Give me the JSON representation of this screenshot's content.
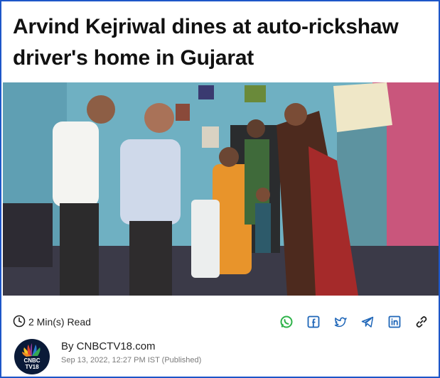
{
  "article": {
    "headline": "Arvind Kejriwal dines at auto-rickshaw driver's home in Gujarat",
    "read_time": "2 Min(s) Read",
    "byline": "By CNBCTV18.com",
    "dateline": "Sep 13, 2022, 12:27 PM IST (Published)"
  },
  "logo": {
    "line1": "CNBC",
    "line2": "TV18"
  },
  "share_icons": [
    "whatsapp-icon",
    "facebook-icon",
    "twitter-icon",
    "telegram-icon",
    "linkedin-icon",
    "link-icon"
  ],
  "colors": {
    "border": "#1d56c8",
    "whatsapp": "#2fb34a",
    "social": "#1f66b8"
  }
}
